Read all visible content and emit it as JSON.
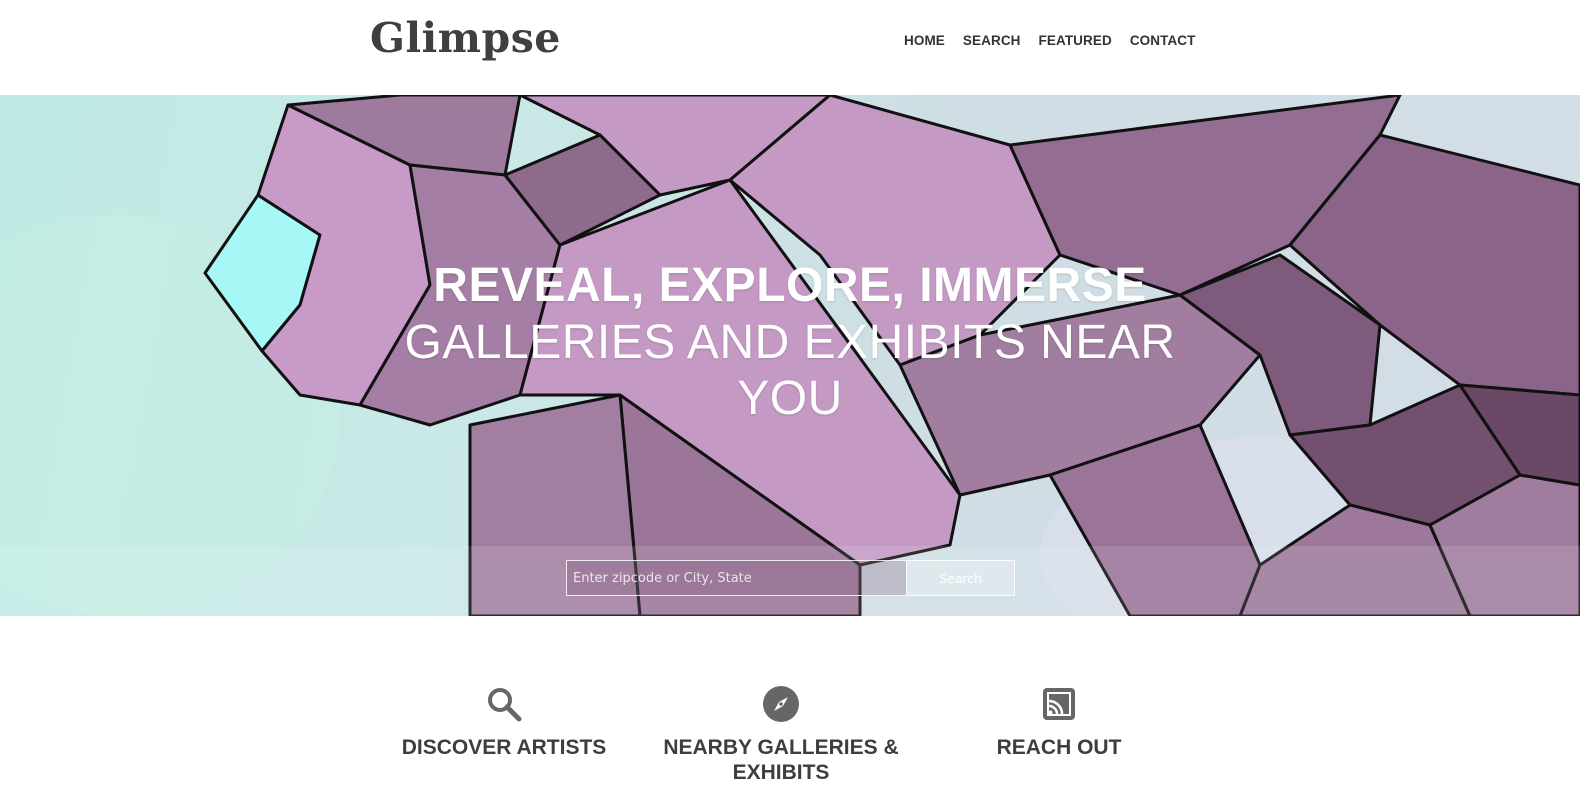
{
  "header": {
    "logo": "Glimpse",
    "nav": [
      "HOME",
      "SEARCH",
      "FEATURED",
      "CONTACT"
    ]
  },
  "hero": {
    "title": "REVEAL, EXPLORE, IMMERSE",
    "subtitle": "GALLERIES AND EXHIBITS NEAR YOU",
    "search_placeholder": "Enter zipcode or City, State",
    "search_button": "Search"
  },
  "features": [
    {
      "icon": "search-icon",
      "title": "DISCOVER ARTISTS",
      "text": ""
    },
    {
      "icon": "compass-icon",
      "title": "NEARBY GALLERIES & EXHIBITS",
      "text": ""
    },
    {
      "icon": "cast-icon",
      "title": "REACH OUT",
      "text": ""
    }
  ],
  "colors": {
    "crystal": "#c49ac5",
    "crystal_dark": "#8f6a8c",
    "text_dark": "#3e3e3e",
    "icon": "#666666"
  }
}
